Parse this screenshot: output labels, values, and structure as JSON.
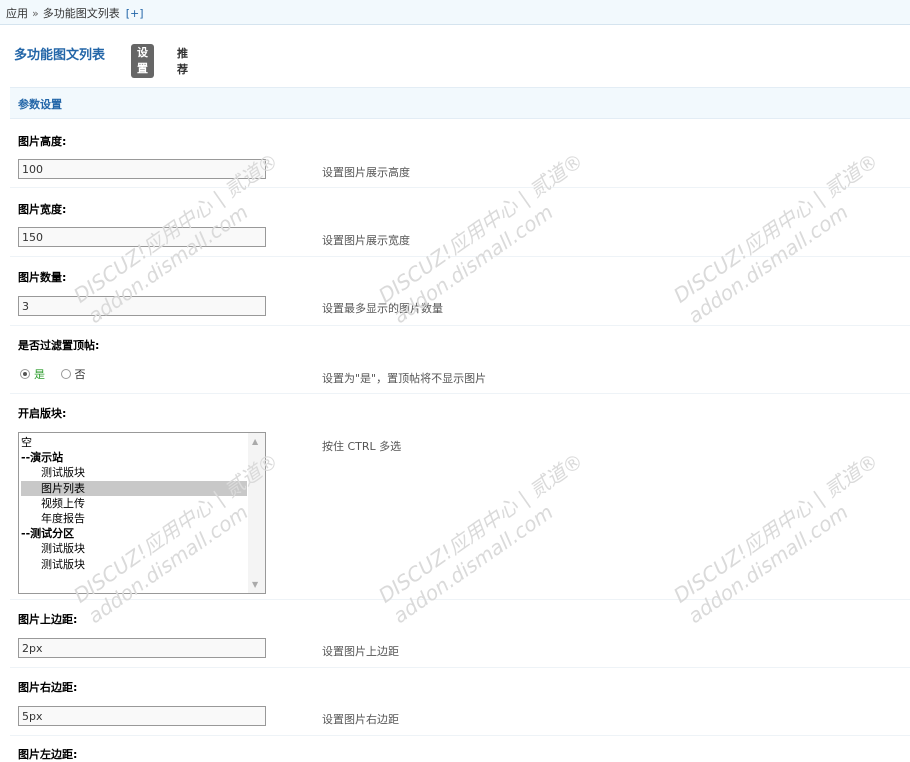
{
  "breadcrumb": {
    "root": "应用",
    "separator": "»",
    "current": "多功能图文列表",
    "add_label": "[+]"
  },
  "header": {
    "title": "多功能图文列表",
    "tab_settings": "设置",
    "tab_recommend": "推荐"
  },
  "section": {
    "title": "参数设置"
  },
  "fields": {
    "img_height": {
      "label": "图片高度:",
      "value": "100",
      "tip": "设置图片展示高度"
    },
    "img_width": {
      "label": "图片宽度:",
      "value": "150",
      "tip": "设置图片展示宽度"
    },
    "img_count": {
      "label": "图片数量:",
      "value": "3",
      "tip": "设置最多显示的图片数量"
    },
    "filter_sticky": {
      "label": "是否过滤置顶帖:",
      "options": [
        "是",
        "否"
      ],
      "selected": "是",
      "tip": "设置为\"是\"，置顶帖将不显示图片"
    },
    "enable_blocks": {
      "label": "开启版块:",
      "tip": "按住 CTRL 多选",
      "items": [
        {
          "text": "空",
          "kind": "plain"
        },
        {
          "text": "--演示站",
          "kind": "group"
        },
        {
          "text": "测试版块",
          "kind": "child"
        },
        {
          "text": "图片列表",
          "kind": "child",
          "selected": true
        },
        {
          "text": "视频上传",
          "kind": "child"
        },
        {
          "text": "年度报告",
          "kind": "child"
        },
        {
          "text": "--测试分区",
          "kind": "group"
        },
        {
          "text": "测试版块",
          "kind": "child"
        },
        {
          "text": "测试版块",
          "kind": "child"
        }
      ]
    },
    "margin_top": {
      "label": "图片上边距:",
      "value": "2px",
      "tip": "设置图片上边距"
    },
    "margin_right": {
      "label": "图片右边距:",
      "value": "5px",
      "tip": "设置图片右边距"
    },
    "margin_left": {
      "label": "图片左边距:"
    }
  },
  "watermark": {
    "line1": "DISCUZ!应用中心 | 贰道®",
    "line2": "addon.dismall.com"
  },
  "colors": {
    "accent": "#2366a8",
    "section_bg": "#f2f9fd",
    "yes_green": "#2b9b2b"
  }
}
